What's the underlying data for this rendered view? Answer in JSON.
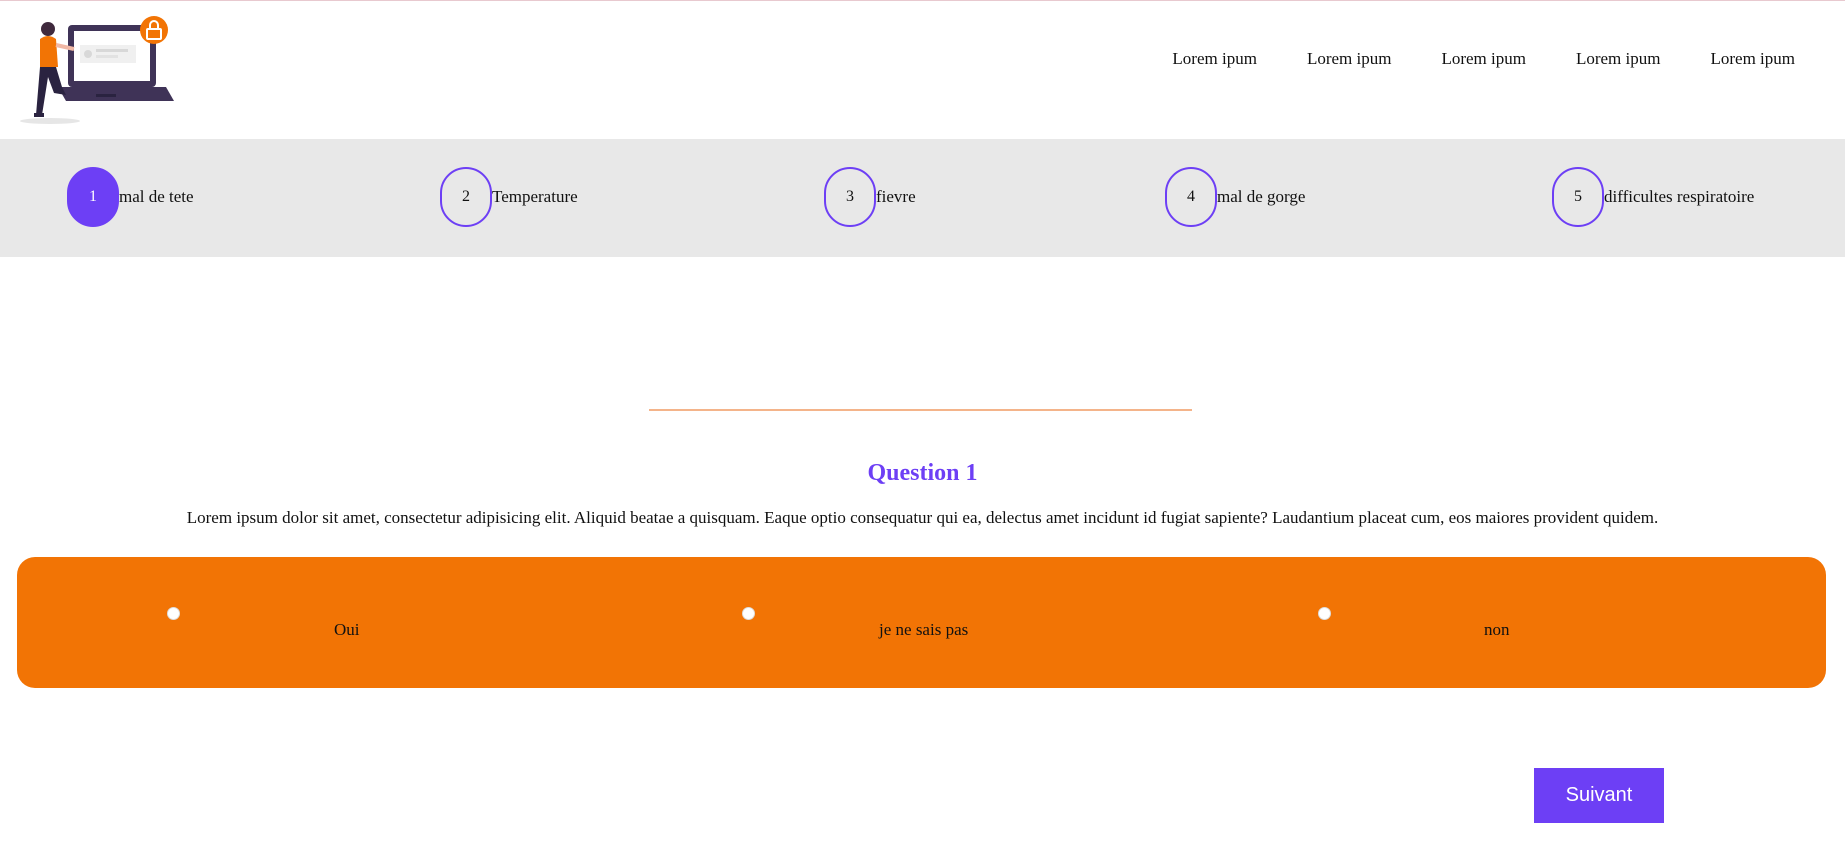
{
  "nav": {
    "items": [
      {
        "label": "Lorem ipum"
      },
      {
        "label": "Lorem ipum"
      },
      {
        "label": "Lorem ipum"
      },
      {
        "label": "Lorem ipum"
      },
      {
        "label": "Lorem ipum"
      }
    ]
  },
  "logo": {
    "icon": "person-laptop-lock-illustration"
  },
  "steps": [
    {
      "number": "1",
      "label": "mal de tete",
      "active": true
    },
    {
      "number": "2",
      "label": "Temperature",
      "active": false
    },
    {
      "number": "3",
      "label": "fievre",
      "active": false
    },
    {
      "number": "4",
      "label": "mal de gorge",
      "active": false
    },
    {
      "number": "5",
      "label": "difficultes respiratoire",
      "active": false
    }
  ],
  "question": {
    "title": "Question 1",
    "text": "Lorem ipsum dolor sit amet, consectetur adipisicing elit. Aliquid beatae a quisquam. Eaque optio consequatur qui ea, delectus amet incidunt id fugiat sapiente? Laudantium placeat cum, eos maiores provident quidem."
  },
  "answers": [
    {
      "label": "Oui"
    },
    {
      "label": "je ne sais pas"
    },
    {
      "label": "non"
    }
  ],
  "actions": {
    "next_label": "Suivant"
  },
  "colors": {
    "accent": "#6d3ff5",
    "answer_panel": "#f27405",
    "stepper_bg": "#e8e8e8",
    "divider": "#f4b48a"
  }
}
